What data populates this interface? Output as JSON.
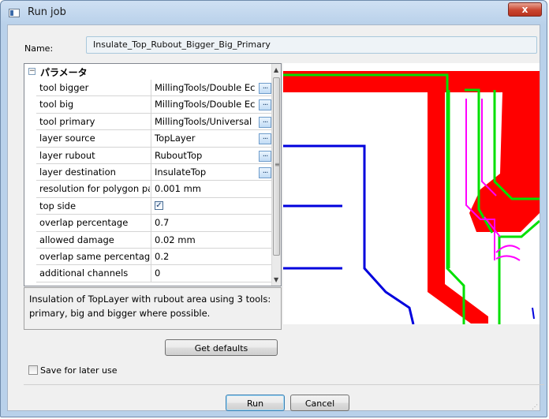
{
  "window": {
    "title": "Run job",
    "close_label": "x"
  },
  "name_field": {
    "label": "Name:",
    "value": "Insulate_Top_Rubout_Bigger_Big_Primary"
  },
  "properties": {
    "section": "パラメータ",
    "rows": [
      {
        "key": "tool bigger",
        "value": "MillingTools/Double Ec",
        "ellipsis": true
      },
      {
        "key": "tool big",
        "value": "MillingTools/Double Ec",
        "ellipsis": true
      },
      {
        "key": "tool primary",
        "value": "MillingTools/Universal",
        "ellipsis": true
      },
      {
        "key": "layer source",
        "value": "TopLayer",
        "ellipsis": true
      },
      {
        "key": "layer rubout",
        "value": "RuboutTop",
        "ellipsis": true
      },
      {
        "key": "layer destination",
        "value": "InsulateTop",
        "ellipsis": true
      },
      {
        "key": "resolution for polygon pa",
        "value": "0.001 mm",
        "ellipsis": false
      },
      {
        "key": "top side",
        "value": "",
        "checkbox": true,
        "checked": true
      },
      {
        "key": "overlap percentage",
        "value": "0.7",
        "ellipsis": false
      },
      {
        "key": "allowed damage",
        "value": "0.02 mm",
        "ellipsis": false
      },
      {
        "key": "overlap same percentage",
        "value": "0.2",
        "ellipsis": false
      },
      {
        "key": "additional channels",
        "value": "0",
        "ellipsis": false
      }
    ],
    "ellipsis_label": "..."
  },
  "description": "Insulation of TopLayer with rubout area using 3 tools: primary, big and bigger where possible.",
  "buttons": {
    "get_defaults": "Get defaults",
    "run": "Run",
    "cancel": "Cancel"
  },
  "save_later": {
    "label": "Save for later use",
    "checked": false
  },
  "colors": {
    "copper": "#ff0000",
    "insulate_path": "#00e000",
    "primary_path": "#0000dd",
    "bigger_path": "#ff00ff"
  }
}
